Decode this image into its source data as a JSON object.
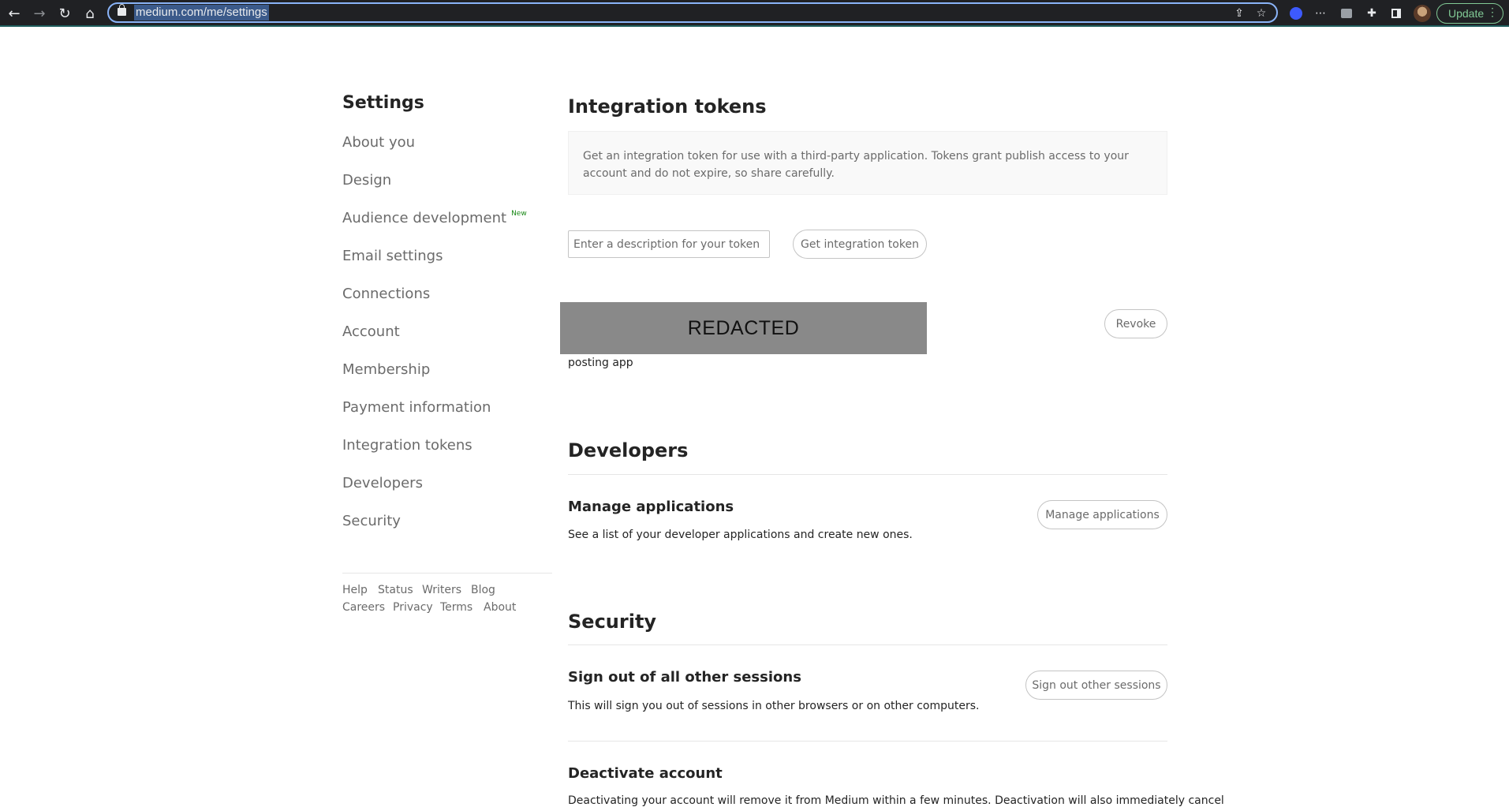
{
  "browser": {
    "url": "medium.com/me/settings",
    "update_label": "Update"
  },
  "sidebar": {
    "title": "Settings",
    "items": [
      {
        "label": "About you"
      },
      {
        "label": "Design"
      },
      {
        "label": "Audience development",
        "badge": "New"
      },
      {
        "label": "Email settings"
      },
      {
        "label": "Connections"
      },
      {
        "label": "Account"
      },
      {
        "label": "Membership"
      },
      {
        "label": "Payment information"
      },
      {
        "label": "Integration tokens"
      },
      {
        "label": "Developers"
      },
      {
        "label": "Security"
      }
    ],
    "footer_links": [
      "Help",
      "Status",
      "Writers",
      "Blog",
      "Careers",
      "Privacy",
      "Terms",
      "About"
    ]
  },
  "integration_tokens": {
    "heading": "Integration tokens",
    "description": "Get an integration token for use with a third-party application. Tokens grant publish access to your account and do not expire, so share carefully.",
    "input_placeholder": "Enter a description for your token",
    "get_button": "Get integration token",
    "token": {
      "redacted_text": "REDACTED",
      "name": "posting app",
      "revoke_button": "Revoke"
    }
  },
  "developers": {
    "heading": "Developers",
    "manage_title": "Manage applications",
    "manage_text": "See a list of your developer applications and create new ones.",
    "manage_button": "Manage applications"
  },
  "security": {
    "heading": "Security",
    "signout_title": "Sign out of all other sessions",
    "signout_text": "This will sign you out of sessions in other browsers or on other computers.",
    "signout_button": "Sign out other sessions",
    "deactivate_title": "Deactivate account",
    "deactivate_text": "Deactivating your account will remove it from Medium within a few minutes. Deactivation will also immediately cancel"
  }
}
